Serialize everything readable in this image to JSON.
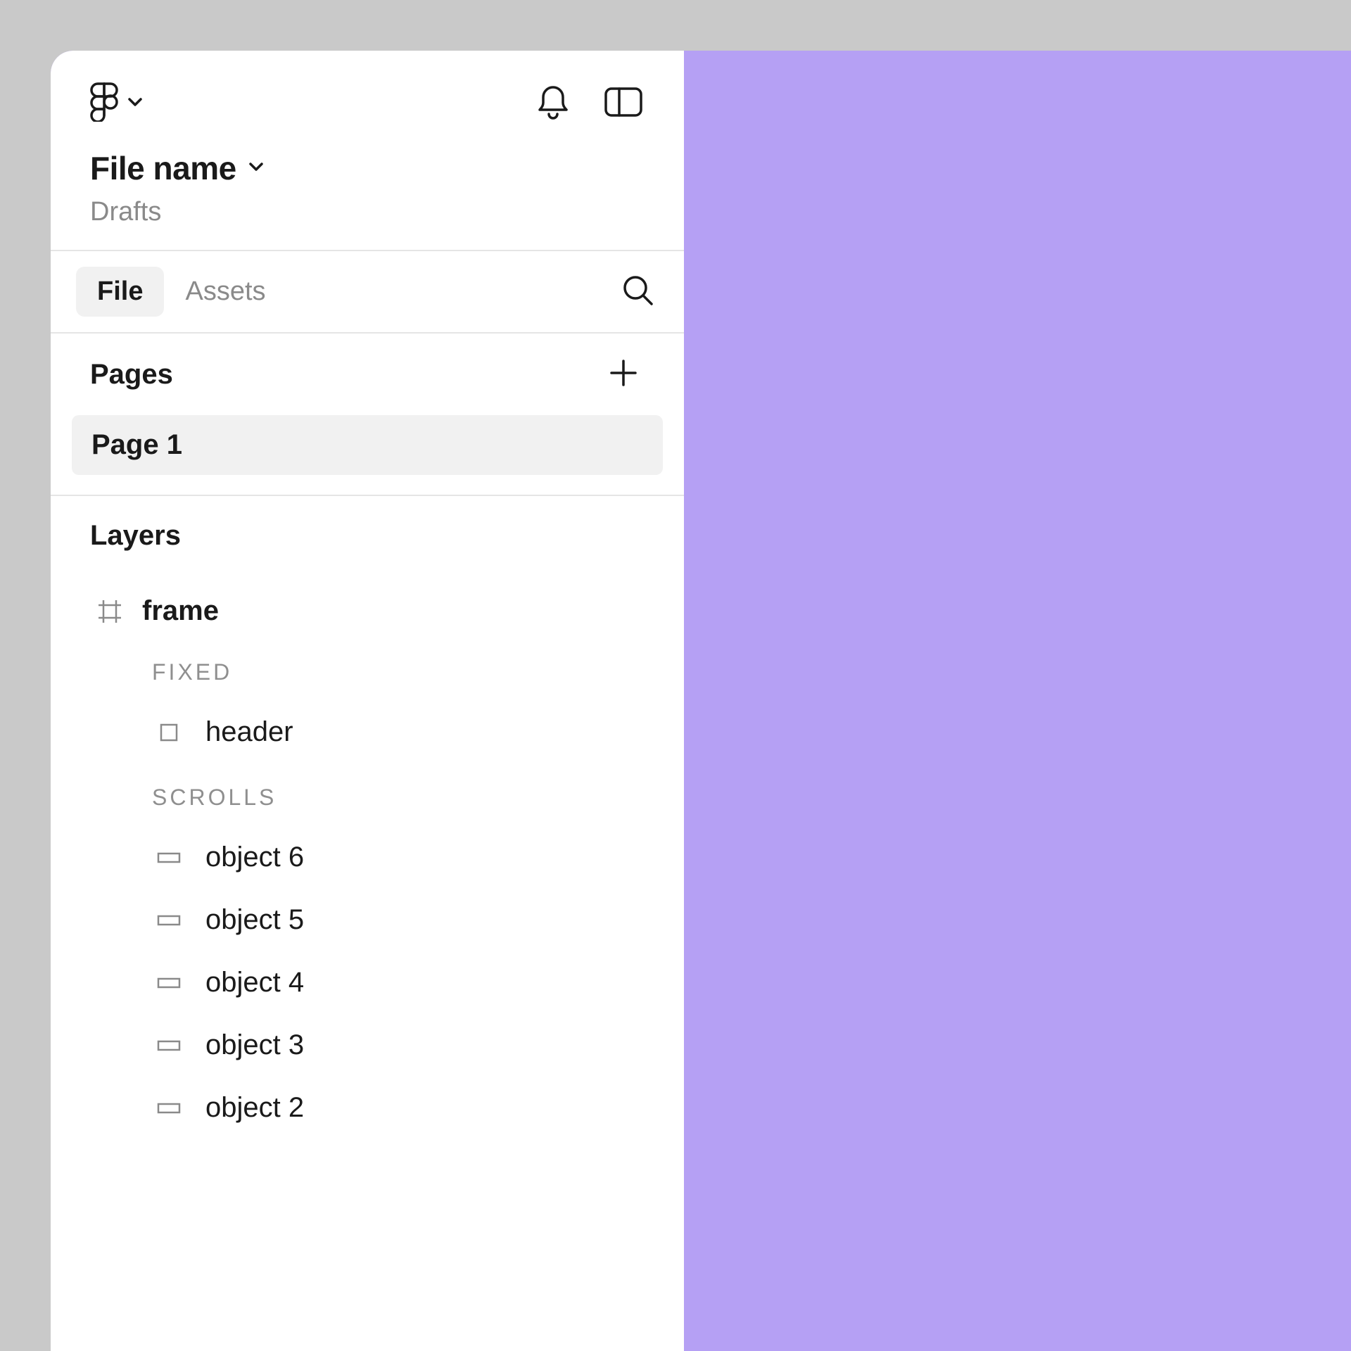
{
  "file": {
    "title": "File name",
    "subtitle": "Drafts"
  },
  "tabs": {
    "file": "File",
    "assets": "Assets"
  },
  "pages": {
    "heading": "Pages",
    "items": [
      "Page 1"
    ]
  },
  "layers": {
    "heading": "Layers",
    "frame": "frame",
    "groups": {
      "fixed": {
        "label": "FIXED",
        "items": [
          "header"
        ]
      },
      "scrolls": {
        "label": "SCROLLS",
        "items": [
          "object 6",
          "object 5",
          "object 4",
          "object 3",
          "object 2"
        ]
      }
    }
  }
}
